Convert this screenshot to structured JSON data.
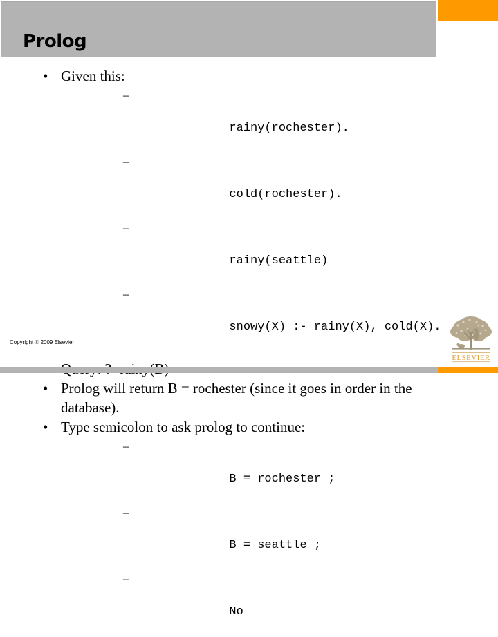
{
  "slide": {
    "title": "Prolog",
    "colors": {
      "accent_orange": "#ff9900",
      "header_gray": "#b3b3b3",
      "text_black": "#000000",
      "logo_tan": "#b8a98c",
      "logo_wordmark": "#e8a33d"
    },
    "bullets": [
      {
        "text": "Given this:",
        "marker": "•",
        "sub_marker": "–",
        "subs": [
          "rainy(rochester).",
          "cold(rochester).",
          "rainy(seattle)",
          "snowy(X) :- rainy(X), cold(X)."
        ]
      },
      {
        "text": "Query: ?- rainy(B)",
        "marker": "•",
        "sub_marker": "–",
        "subs": []
      },
      {
        "text": "Prolog will return B = rochester (since it goes in order in the database).",
        "marker": "•",
        "sub_marker": "–",
        "subs": []
      },
      {
        "text": "Type semicolon to ask prolog to continue:",
        "marker": "•",
        "sub_marker": "–",
        "subs": [
          "B = rochester ;",
          "B = seattle ;",
          "No"
        ]
      }
    ]
  },
  "footer": {
    "copyright": "Copyright © 2009 Elsevier",
    "logo_wordmark": "ELSEVIER",
    "logo_alt": "elsevier-tree-logo"
  }
}
